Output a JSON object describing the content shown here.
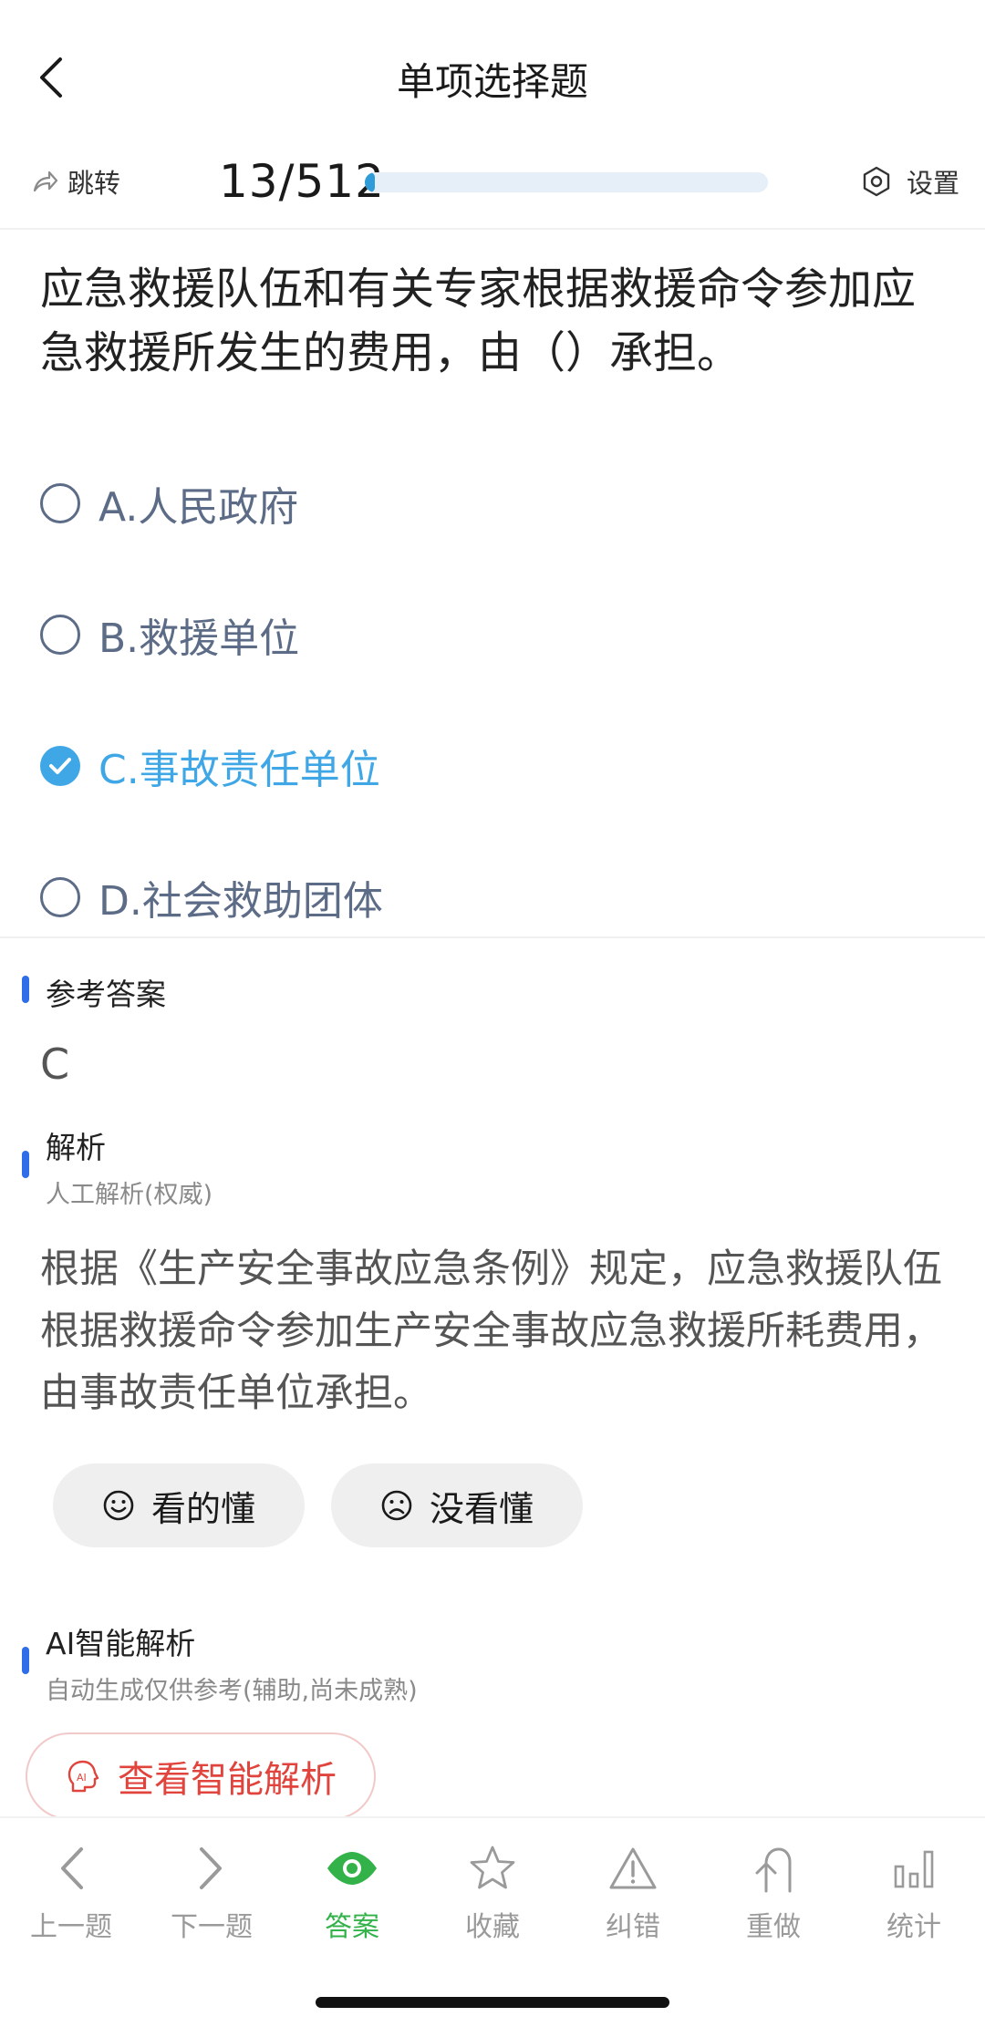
{
  "header": {
    "title": "单项选择题"
  },
  "progress": {
    "jump_label": "跳转",
    "counter": "13/512",
    "current": 13,
    "total": 512,
    "settings_label": "设置"
  },
  "question": {
    "text": "应急救援队伍和有关专家根据救援命令参加应急救援所发生的费用，由（）承担。",
    "options": [
      {
        "label": "A.人民政府",
        "selected": false
      },
      {
        "label": "B.救援单位",
        "selected": false
      },
      {
        "label": "C.事故责任单位",
        "selected": true
      },
      {
        "label": "D.社会救助团体",
        "selected": false
      }
    ]
  },
  "answer": {
    "title": "参考答案",
    "value": "C"
  },
  "analysis": {
    "title": "解析",
    "subtitle": "人工解析(权威)",
    "text": "根据《生产安全事故应急条例》规定，应急救援队伍根据救援命令参加生产安全事故应急救援所耗费用，由事故责任单位承担。",
    "understood_label": "看的懂",
    "not_understood_label": "没看懂"
  },
  "ai_analysis": {
    "title": "AI智能解析",
    "subtitle": "自动生成仅供参考(辅助,尚未成熟)",
    "button_label": "查看智能解析"
  },
  "bottom_nav": {
    "items": [
      {
        "label": "上一题",
        "icon": "chevron-left-icon",
        "active": false
      },
      {
        "label": "下一题",
        "icon": "chevron-right-icon",
        "active": false
      },
      {
        "label": "答案",
        "icon": "eye-icon",
        "active": true
      },
      {
        "label": "收藏",
        "icon": "star-icon",
        "active": false
      },
      {
        "label": "纠错",
        "icon": "warning-icon",
        "active": false
      },
      {
        "label": "重做",
        "icon": "redo-icon",
        "active": false
      },
      {
        "label": "统计",
        "icon": "bar-chart-icon",
        "active": false
      }
    ]
  },
  "colors": {
    "accent": "#3fa7e6",
    "active_nav": "#33b24a",
    "section_mark": "#2f6ee8",
    "ai_red": "#e0443c"
  }
}
